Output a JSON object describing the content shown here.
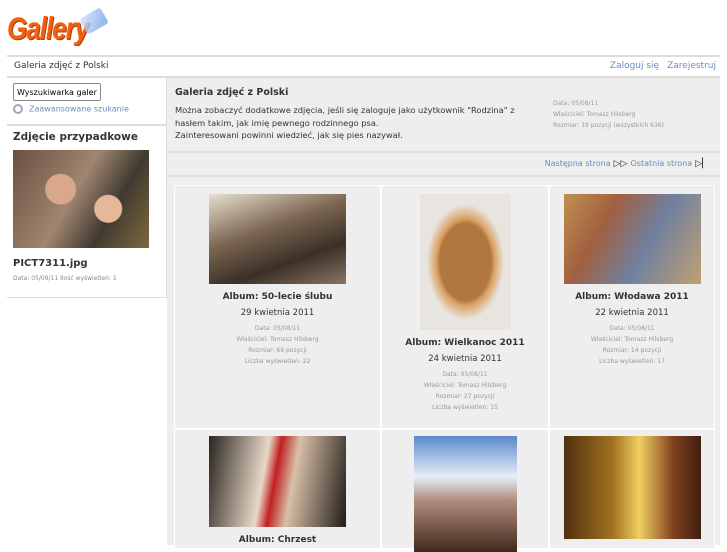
{
  "logo": {
    "text": "Gallery"
  },
  "header": {
    "title": "Galeria zdjęć z Polski",
    "login": "Zaloguj się",
    "register": "Zarejestruj"
  },
  "sidebar": {
    "search_placeholder": "Wyszukiwarka galerii",
    "advanced_search": "Zaawansowane szukanie",
    "random_heading": "Zdjęcie przypadkowe",
    "random_name": "PICT7311.jpg",
    "random_meta": "Data: 05/09/11 Ilość wyświetleń: 1"
  },
  "gallery": {
    "title": "Galeria zdjęć z Polski",
    "desc1": "Można zobaczyć dodatkowe zdjęcia, jeśli się zaloguje jako użytkownik \"Rodzina\" z hasłem takim, jak imię pewnego rodzinnego psa.",
    "desc2": "Zainteresowani powinni wiedzieć, jak się pies nazywał.",
    "date": "Data: 05/08/11",
    "owner": "Właściciel: Tomasz Hilsberg",
    "size": "Rozmiar: 19 pozycji (wszystkich 636)"
  },
  "pager": {
    "next": "Następna strona",
    "last": "Ostatnia strona"
  },
  "albums": [
    {
      "title": "Album: 50-lecie ślubu",
      "date": "29 kwietnia 2011",
      "meta_date": "Data: 05/08/11",
      "owner": "Właściciel: Tomasz Hilsberg",
      "size": "Rozmiar: 69 pozycji",
      "views": "Liczba wyświetleń: 22"
    },
    {
      "title": "Album: Wielkanoc 2011",
      "date": "24 kwietnia 2011",
      "meta_date": "Data: 05/08/11",
      "owner": "Właściciel: Tomasz Hilsberg",
      "size": "Rozmiar: 27 pozycji",
      "views": "Liczba wyświetleń: 15"
    },
    {
      "title": "Album: Włodawa 2011",
      "date": "22 kwietnia 2011",
      "meta_date": "Data: 05/08/11",
      "owner": "Właściciel: Tomasz Hilsberg",
      "size": "Rozmiar: 14 pozycji",
      "views": "Liczba wyświetleń: 17"
    },
    {
      "title": "Album: Chrzest"
    }
  ]
}
